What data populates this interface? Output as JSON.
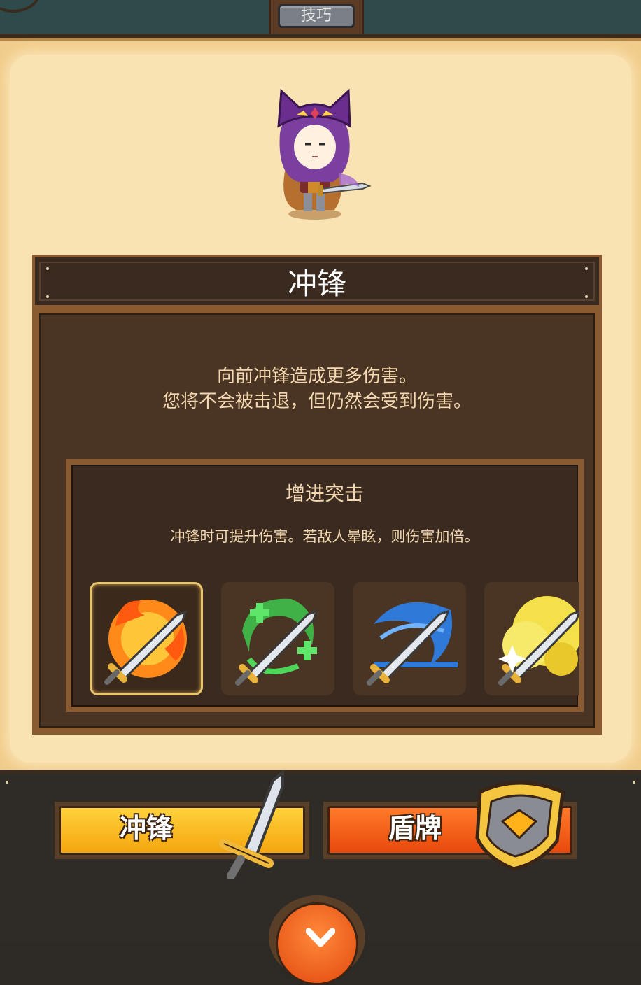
{
  "header": {
    "tab_label": "技巧"
  },
  "skill": {
    "title": "冲锋",
    "description_line1": "向前冲锋造成更多伤害。",
    "description_line2": "您将不会被击退，但仍然会受到伤害。"
  },
  "upgrade": {
    "title": "增进突击",
    "description": "冲锋时可提升伤害。若敌人晕眩，则伤害加倍。",
    "options": [
      {
        "icon": "fire-sword-icon",
        "selected": true
      },
      {
        "icon": "heal-sword-icon",
        "selected": false
      },
      {
        "icon": "water-sword-icon",
        "selected": false
      },
      {
        "icon": "light-sword-icon",
        "selected": false
      }
    ]
  },
  "bottom_tabs": {
    "charge_label": "冲锋",
    "shield_label": "盾牌"
  },
  "colors": {
    "parchment": "#fae3b3",
    "panel_dark": "#3a2a20",
    "panel_frame": "#8a5a30",
    "text_light": "#f3d8b0",
    "charge_yellow": "#f4a510",
    "shield_orange": "#e8490c",
    "selected_border": "#e8c46a"
  }
}
